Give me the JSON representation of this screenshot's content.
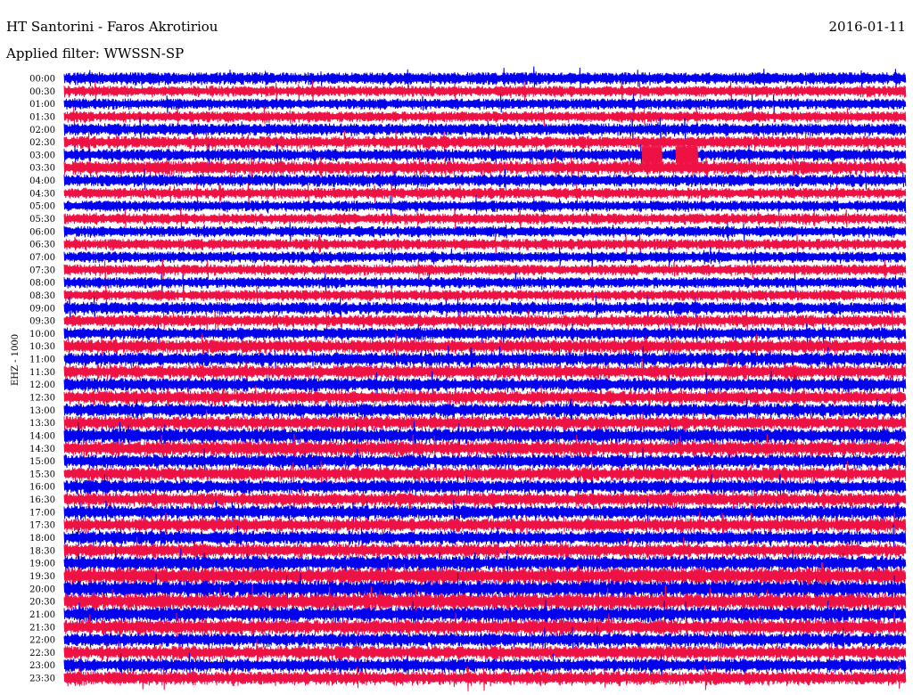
{
  "header": {
    "title": "HT Santorini - Faros Akrotiriou",
    "date": "2016-01-11",
    "filter": "Applied filter: WWSSN-SP"
  },
  "chart_data": {
    "type": "line",
    "title": "HT Santorini - Faros Akrotiriou",
    "subtitle": "Applied filter: WWSSN-SP",
    "date": "2016-01-11",
    "ylabel": "EHZ - 1000",
    "row_labels": [
      "00:00",
      "00:30",
      "01:00",
      "01:30",
      "02:00",
      "02:30",
      "03:00",
      "03:30",
      "04:00",
      "04:30",
      "05:00",
      "05:30",
      "06:00",
      "06:30",
      "07:00",
      "07:30",
      "08:00",
      "08:30",
      "09:00",
      "09:30",
      "10:00",
      "10:30",
      "11:00",
      "11:30",
      "12:00",
      "12:30",
      "13:00",
      "13:30",
      "14:00",
      "14:30",
      "15:00",
      "15:30",
      "16:00",
      "16:30",
      "17:00",
      "17:30",
      "18:00",
      "18:30",
      "19:00",
      "19:30",
      "20:00",
      "20:30",
      "21:00",
      "21:30",
      "22:00",
      "22:30",
      "23:00",
      "23:30"
    ],
    "series_colors": [
      "#0000ee",
      "#ee1144"
    ],
    "grid": false,
    "events": [
      {
        "row": "03:00",
        "start_minute": 20.6,
        "end_minute": 21.3,
        "color": "#ee1144"
      },
      {
        "row": "03:00",
        "start_minute": 21.8,
        "end_minute": 22.6,
        "color": "#ee1144"
      }
    ],
    "note_amplitude_by_row": [
      0.9,
      0.8,
      0.8,
      0.8,
      0.9,
      0.9,
      0.9,
      1.0,
      0.9,
      0.8,
      0.8,
      0.8,
      0.8,
      0.8,
      0.8,
      0.8,
      0.8,
      0.8,
      0.9,
      0.9,
      0.9,
      1.0,
      1.0,
      1.0,
      1.0,
      1.0,
      1.0,
      1.0,
      1.1,
      1.1,
      1.0,
      1.0,
      1.0,
      1.0,
      1.0,
      1.0,
      1.0,
      1.0,
      1.1,
      1.2,
      1.2,
      1.2,
      1.1,
      1.1,
      1.0,
      1.0,
      1.0,
      1.0
    ]
  }
}
